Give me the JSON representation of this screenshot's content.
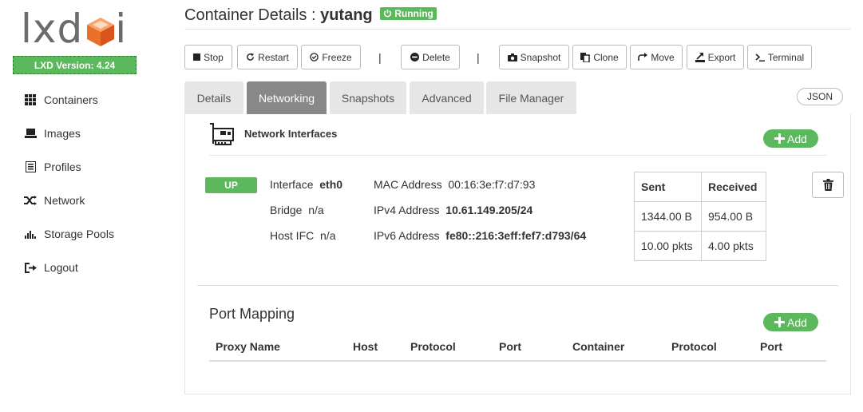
{
  "brand": {
    "logo_text": "lxd",
    "logo_suffix": "i",
    "version_label": "LXD Version: 4.24",
    "accent": "#5cb85c"
  },
  "sidebar": {
    "items": [
      {
        "label": "Containers",
        "icon": "grid-icon"
      },
      {
        "label": "Images",
        "icon": "disk-icon"
      },
      {
        "label": "Profiles",
        "icon": "list-icon"
      },
      {
        "label": "Network",
        "icon": "shuffle-icon"
      },
      {
        "label": "Storage Pools",
        "icon": "storage-bars-icon"
      },
      {
        "label": "Logout",
        "icon": "logout-icon"
      }
    ]
  },
  "header": {
    "title_prefix": "Container Details : ",
    "container_name": "yutang",
    "status": "Running"
  },
  "toolbar": {
    "stop": "Stop",
    "restart": "Restart",
    "freeze": "Freeze",
    "delete": "Delete",
    "snapshot": "Snapshot",
    "clone": "Clone",
    "move": "Move",
    "export": "Export",
    "terminal": "Terminal",
    "separator": "|"
  },
  "tabs": [
    {
      "label": "Details"
    },
    {
      "label": "Networking"
    },
    {
      "label": "Snapshots"
    },
    {
      "label": "Advanced"
    },
    {
      "label": "File Manager"
    }
  ],
  "json_label": "JSON",
  "network": {
    "title": "Network Interfaces",
    "add_label": "Add",
    "interface": {
      "state": "UP",
      "interface_label": "Interface",
      "interface_value": "eth0",
      "bridge_label": "Bridge",
      "bridge_value": "n/a",
      "host_ifc_label": "Host IFC",
      "host_ifc_value": "n/a",
      "mac_label": "MAC Address",
      "mac_value": "00:16:3e:f7:d7:93",
      "ipv4_label": "IPv4 Address",
      "ipv4_value": "10.61.149.205/24",
      "ipv6_label": "IPv6 Address",
      "ipv6_value": "fe80::216:3eff:fef7:d793/64"
    },
    "stats": {
      "headers": [
        "Sent",
        "Received"
      ],
      "rows": [
        [
          "1344.00 B",
          "954.00 B"
        ],
        [
          "10.00 pkts",
          "4.00 pkts"
        ]
      ]
    }
  },
  "port_mapping": {
    "title": "Port Mapping",
    "add_label": "Add",
    "columns": [
      "Proxy Name",
      "Host",
      "Protocol",
      "Port",
      "Container",
      "Protocol",
      "Port"
    ]
  }
}
